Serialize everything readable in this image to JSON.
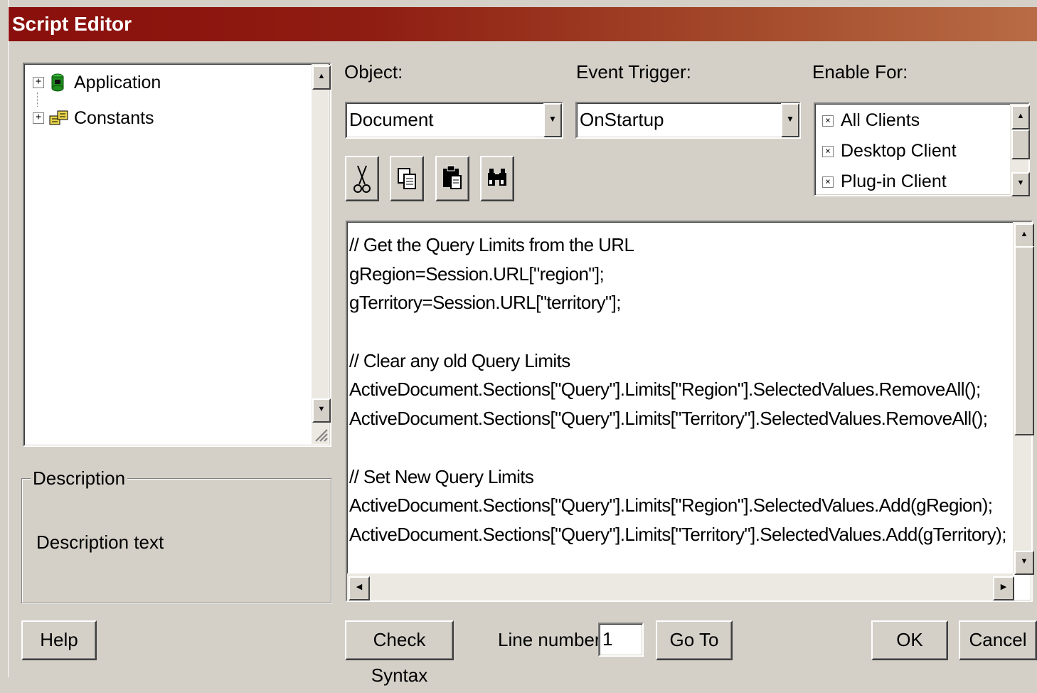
{
  "window": {
    "title": "Script Editor"
  },
  "tree": {
    "items": [
      {
        "label": "Application",
        "icon": "green-cylinder-icon"
      },
      {
        "label": "Constants",
        "icon": "constants-icon"
      }
    ]
  },
  "description": {
    "legend": "Description",
    "text": "Description text"
  },
  "object": {
    "label": "Object:",
    "value": "Document"
  },
  "event_trigger": {
    "label": "Event Trigger:",
    "value": "OnStartup"
  },
  "enable_for": {
    "label": "Enable For:",
    "items": [
      {
        "label": "All Clients",
        "checked": true
      },
      {
        "label": "Desktop Client",
        "checked": true
      },
      {
        "label": "Plug-in Client",
        "checked": true
      }
    ]
  },
  "toolbar": {
    "buttons": [
      {
        "icon": "cut-icon"
      },
      {
        "icon": "copy-icon"
      },
      {
        "icon": "paste-icon"
      },
      {
        "icon": "find-icon"
      }
    ]
  },
  "code": {
    "lines": [
      "// Get the Query Limits from the URL",
      "gRegion=Session.URL[\"region\"];",
      "gTerritory=Session.URL[\"territory\"];",
      "",
      "// Clear any old Query Limits",
      "ActiveDocument.Sections[\"Query\"].Limits[\"Region\"].SelectedValues.RemoveAll();",
      "ActiveDocument.Sections[\"Query\"].Limits[\"Territory\"].SelectedValues.RemoveAll();",
      "",
      "// Set New Query Limits",
      "ActiveDocument.Sections[\"Query\"].Limits[\"Region\"].SelectedValues.Add(gRegion);",
      "ActiveDocument.Sections[\"Query\"].Limits[\"Territory\"].SelectedValues.Add(gTerritory);"
    ]
  },
  "footer": {
    "help_label": "Help",
    "check_syntax_label": "Check Syntax",
    "line_number_label": "Line number:",
    "line_number_value": "1",
    "goto_label": "Go To",
    "ok_label": "OK",
    "cancel_label": "Cancel"
  }
}
